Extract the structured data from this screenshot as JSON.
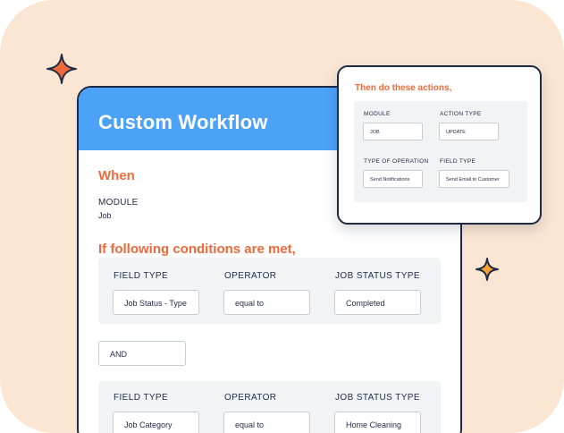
{
  "colors": {
    "background": "#fbe6d3",
    "header_blue": "#4ca2f7",
    "accent_orange": "#ee6a3b",
    "text_dark": "#1f2a44",
    "panel_gray": "#f1f3f5"
  },
  "decorations": [
    "sparkle-star-icon",
    "sparkle-star-icon"
  ],
  "workflow": {
    "title": "Custom Workflow",
    "when_heading": "When",
    "module_label": "MODULE",
    "module_value": "Job",
    "conditions_heading": "If following conditions are met,",
    "and_label": "AND",
    "conditions": [
      {
        "labels": [
          "FIELD TYPE",
          "OPERATOR",
          "JOB STATUS TYPE"
        ],
        "values": [
          "Job Status - Type",
          "equal to",
          "Completed"
        ]
      },
      {
        "labels": [
          "FIELD TYPE",
          "OPERATOR",
          "JOB STATUS TYPE"
        ],
        "values": [
          "Job Category",
          "equal to",
          "Home Cleaning"
        ]
      }
    ]
  },
  "actions": {
    "title": "Then do these actions,",
    "module_label": "MODULE",
    "module_value": "JOB",
    "action_type_label": "ACTION TYPE",
    "action_type_value": "UPDATE",
    "operation_label": "TYPE OF OPERATION",
    "operation_value": "Send Notifications",
    "field_type_label": "FIELD TYPE",
    "field_type_value": "Send Email to Customer"
  }
}
